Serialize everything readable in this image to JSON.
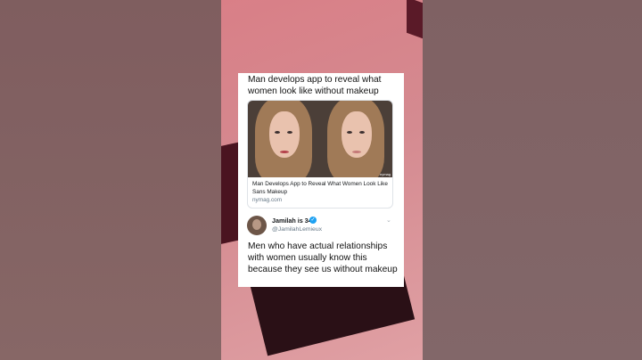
{
  "card": {
    "headline": "Man develops app to reveal what women look like without makeup",
    "article": {
      "title": "Man Develops App to Reveal What Women Look Like Sans Makeup",
      "domain": "nymag.com",
      "image_tag": "nymag"
    },
    "tweet": {
      "display_name": "Jamilah is 34",
      "handle": "@JamilahLemieux",
      "text": "Men who have actual relationships with women usually know this because they see us without makeup"
    }
  },
  "icons": {
    "verified": "verified-badge-icon",
    "chevron": "chevron-down-icon",
    "avatar": "user-avatar"
  },
  "colors": {
    "background_pink": "#d98a90",
    "verified_blue": "#1da1f2",
    "card_bg": "#ffffff"
  }
}
